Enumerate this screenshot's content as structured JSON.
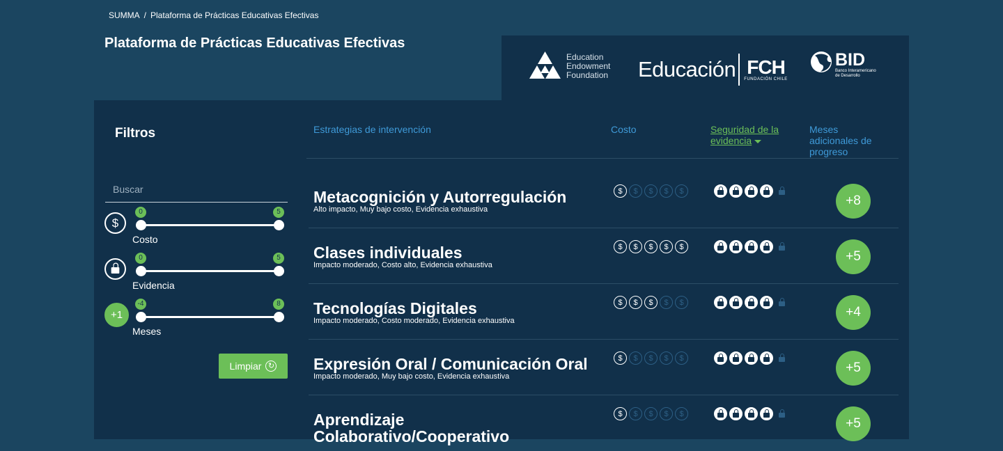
{
  "breadcrumb": {
    "home": "SUMMA",
    "separator": "/",
    "current": "Plataforma de Prácticas Educativas Efectivas"
  },
  "page_title": "Plataforma de Prácticas Educativas Efectivas",
  "logos": {
    "eef": {
      "lines": [
        "Education",
        "Endowment",
        "Foundation"
      ]
    },
    "educacion": {
      "word": "Educación",
      "mark": "FCH",
      "sub": "FUNDACIÓN CHILE"
    },
    "bid": {
      "mark": "BID",
      "sub": [
        "Banco Interamericano",
        "de Desarrollo"
      ]
    }
  },
  "filters": {
    "title": "Filtros",
    "search_placeholder": "Buscar",
    "sliders": [
      {
        "label": "Costo",
        "icon": "dollar-icon",
        "icon_text": "$",
        "min": "0",
        "max": "5"
      },
      {
        "label": "Evidencia",
        "icon": "lock-icon",
        "icon_text": "",
        "min": "0",
        "max": "5"
      },
      {
        "label": "Meses",
        "icon": "months-icon",
        "icon_text": "+1",
        "min": "-4",
        "max": "8"
      }
    ],
    "clear_label": "Limpiar"
  },
  "table": {
    "headers": {
      "strategy": "Estrategias de intervención",
      "cost": "Costo",
      "security_line1": "Seguridad de la",
      "security_line2": "evidencia",
      "months_line1": "Meses",
      "months_line2": "adicionales de",
      "months_line3": "progreso"
    },
    "rows": [
      {
        "title": "Metacognición y Autorregulación",
        "subtitle": "Alto impacto, Muy bajo costo, Evidencia exhaustiva",
        "cost": 1,
        "security": 4,
        "months": "+8"
      },
      {
        "title": "Clases individuales",
        "subtitle": "Impacto moderado, Costo alto, Evidencia exhaustiva",
        "cost": 5,
        "security": 4,
        "months": "+5"
      },
      {
        "title": "Tecnologías Digitales",
        "subtitle": "Impacto moderado, Costo moderado, Evidencia exhaustiva",
        "cost": 3,
        "security": 4,
        "months": "+4"
      },
      {
        "title": "Expresión Oral / Comunicación Oral",
        "subtitle": "Impacto moderado, Muy bajo costo, Evidencia exhaustiva",
        "cost": 1,
        "security": 4,
        "months": "+5"
      },
      {
        "title": "Aprendizaje Colaborativo/Cooperativo",
        "subtitle": "",
        "cost": 1,
        "security": 4,
        "months": "+5"
      }
    ]
  },
  "colors": {
    "background": "#1b4560",
    "panel": "#11304a",
    "accent_green": "#6cbf58",
    "link_blue": "#3f9ad8"
  }
}
